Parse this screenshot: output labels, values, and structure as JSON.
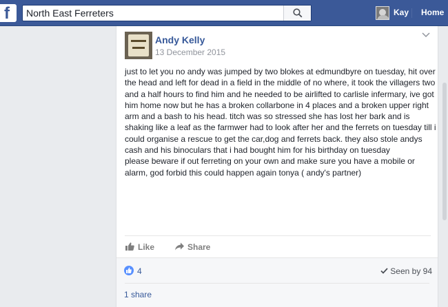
{
  "header": {
    "search_value": "North East Ferreters",
    "profile_name": "Kay",
    "home_label": "Home"
  },
  "post": {
    "author": "Andy Kelly",
    "date": "13 December 2015",
    "body": [
      "just to let you no andy was jumped by two blokes at edmundbyre on tuesday, hit over the head and left for dead in a field in the middle of no where, it took the villagers two and a half hours to find him and he needed to be airlifted to carlisle infermary, ive got him home now but he has a broken collarbone in 4 places and a broken upper right arm and a bash to his head. titch was so stressed she has lost her bark and is shaking like a leaf as the farmwer had to look after her and the ferrets on tuesday till i could organise a rescue to get the car,dog and ferrets back. they also stole andys cash and his binoculars that i had bought him for his birthday on tuesday",
      "please beware if out ferreting on your own and make sure you have a mobile or alarm, god forbid this could happen again tonya ( andy's partner)"
    ],
    "actions": {
      "like_label": "Like",
      "share_label": "Share"
    },
    "stats": {
      "like_count": "4",
      "seen_label": "Seen by 94",
      "shares_label": "1 share"
    }
  },
  "colors": {
    "brand": "#3b5998",
    "link": "#365899",
    "like_blue": "#5890ff"
  },
  "icons": [
    "facebook-logo-icon",
    "search-icon",
    "chevron-down-icon",
    "thumbs-up-icon",
    "share-arrow-icon",
    "checkmark-icon"
  ]
}
